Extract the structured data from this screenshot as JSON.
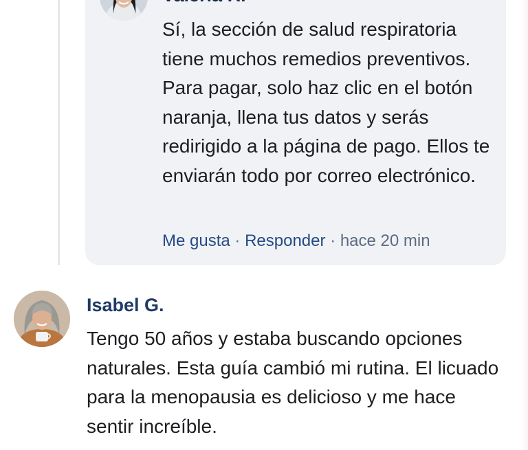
{
  "reply": {
    "author": "Valeria R.",
    "text": "Sí, la sección de salud respiratoria tiene muchos remedios preventivos. Para pagar, solo haz clic en el botón naranja, llena tus datos y serás redirigido a la página de pago. Ellos te enviarán todo por correo electrónico.",
    "like_label": "Me gusta",
    "reply_label": "Responder",
    "separator": "·",
    "time": "hace 20 min"
  },
  "comment": {
    "author": "Isabel G.",
    "text": "Tengo 50 años y estaba buscando opciones naturales. Esta guía cambió mi rutina. El licuado para la menopausia es delicioso y me hace sentir increíble."
  },
  "colors": {
    "bubble": "#f0f2f5",
    "name": "#1f3a66",
    "link": "#244a85",
    "text": "#1c1e21"
  }
}
